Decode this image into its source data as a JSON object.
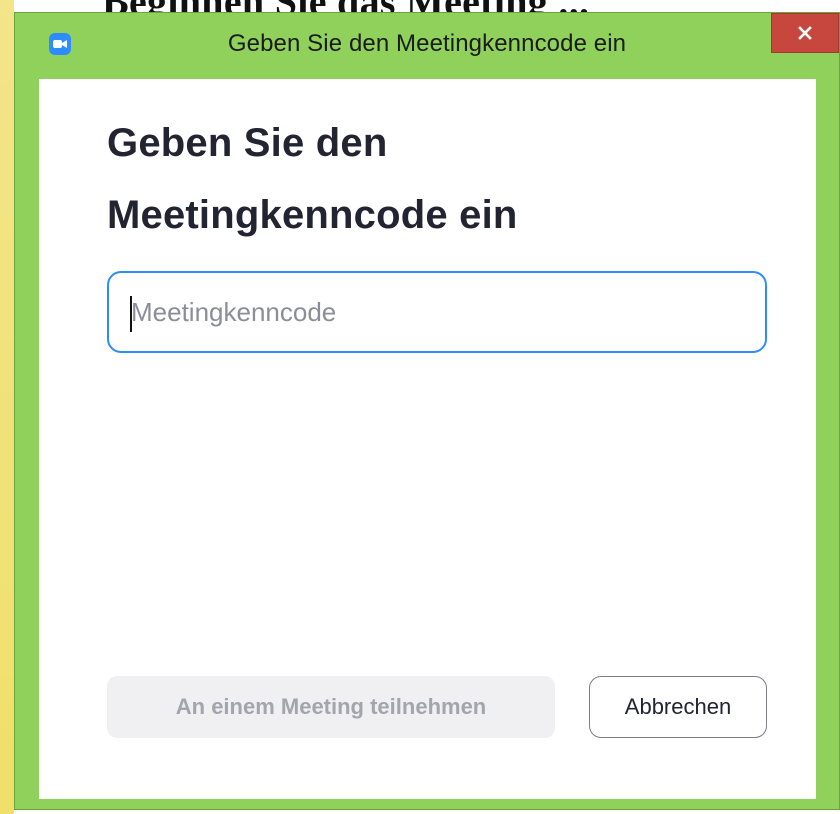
{
  "background": {
    "cropped_text": "Beginnen Sie das Meeting ..."
  },
  "window": {
    "title": "Geben Sie den Meetingkenncode ein",
    "icons": {
      "app": "zoom-camera-icon",
      "close": "close-icon"
    },
    "colors": {
      "frame": "#8fd15a",
      "close": "#c7473e",
      "accent": "#2d8cff"
    }
  },
  "dialog": {
    "heading_line1": "Geben Sie den",
    "heading_line2": "Meetingkenncode ein",
    "input": {
      "placeholder": "Meetingkenncode",
      "value": ""
    },
    "buttons": {
      "join_label": "An einem Meeting teilnehmen",
      "cancel_label": "Abbrechen"
    }
  }
}
